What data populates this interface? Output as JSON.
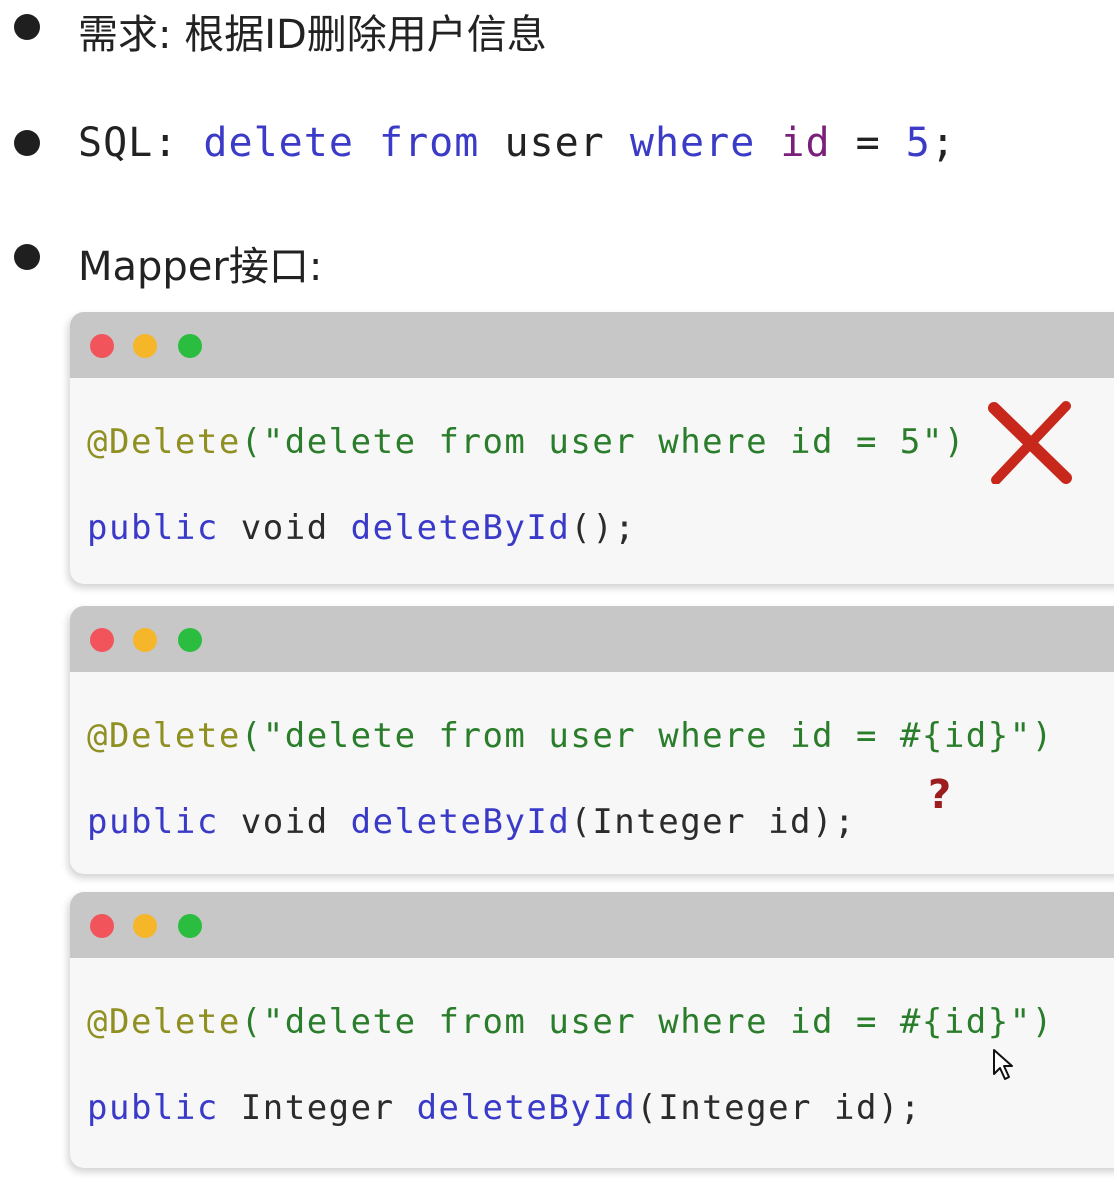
{
  "bullets": [
    {
      "text": "需求: 根据ID删除用户信息"
    },
    {
      "sql_label": "SQL: ",
      "sql": [
        "delete",
        " ",
        "from",
        " ",
        "user",
        " ",
        "where",
        " ",
        "id",
        " = ",
        "5",
        ";"
      ]
    },
    {
      "text": "Mapper接口:"
    }
  ],
  "windows": [
    {
      "annotation": "@Delete",
      "string": "(\"delete from user where id = 5\")",
      "line2": {
        "kw": "public",
        "type": " void ",
        "fn": "deleteById",
        "rest": "();"
      },
      "mark": "cross-icon"
    },
    {
      "annotation": "@Delete",
      "string": "(\"delete from user where id = #{id}\")",
      "line2": {
        "kw": "public",
        "type": " void ",
        "fn": "deleteById",
        "rest": "(Integer id);"
      },
      "mark": "?"
    },
    {
      "annotation": "@Delete",
      "string": "(\"delete from user where id = #{id}\")",
      "line2": {
        "kw": "public",
        "type": " Integer ",
        "fn": "deleteById",
        "rest": "(Integer id);"
      },
      "mark": "cursor-icon"
    }
  ],
  "colors": {
    "red": "#f2545b",
    "yellow": "#f5b62a",
    "green": "#2bbd3f",
    "cross": "#c8271b"
  }
}
